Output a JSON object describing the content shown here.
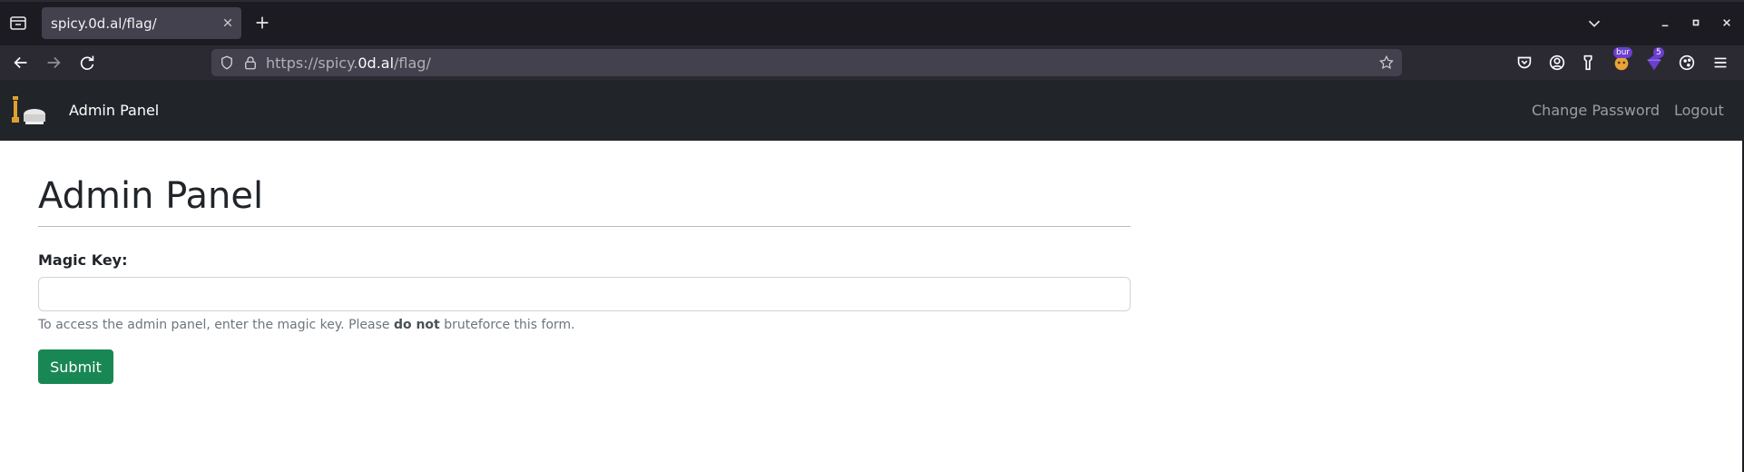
{
  "browser": {
    "tab": {
      "title": "spicy.0d.al/flag/"
    },
    "url": {
      "prefix": "https://spicy.",
      "host": "0d.al",
      "path": "/flag/"
    },
    "extension_badges": {
      "ext1": "bur",
      "ext2": "5"
    }
  },
  "site": {
    "brand": "Admin Panel",
    "nav": {
      "change_password": "Change Password",
      "logout": "Logout"
    }
  },
  "page": {
    "title": "Admin Panel",
    "form": {
      "label": "Magic Key:",
      "input_value": "",
      "help_before": "To access the admin panel, enter the magic key. Please ",
      "help_bold": "do not",
      "help_after": " bruteforce this form.",
      "submit_label": "Submit"
    }
  },
  "colors": {
    "browser_chrome": "#1c1b22",
    "toolbar": "#2b2a33",
    "site_navbar": "#212529",
    "submit_button": "#198754"
  },
  "icons": [
    "tab-list-icon",
    "close-icon",
    "plus-icon",
    "chevron-down-icon",
    "minimize-icon",
    "maximize-icon",
    "back-arrow-icon",
    "forward-arrow-icon",
    "reload-icon",
    "shield-icon",
    "lock-icon",
    "star-icon",
    "pocket-icon",
    "account-icon",
    "extensions-icon",
    "hamburger-menu-icon"
  ]
}
